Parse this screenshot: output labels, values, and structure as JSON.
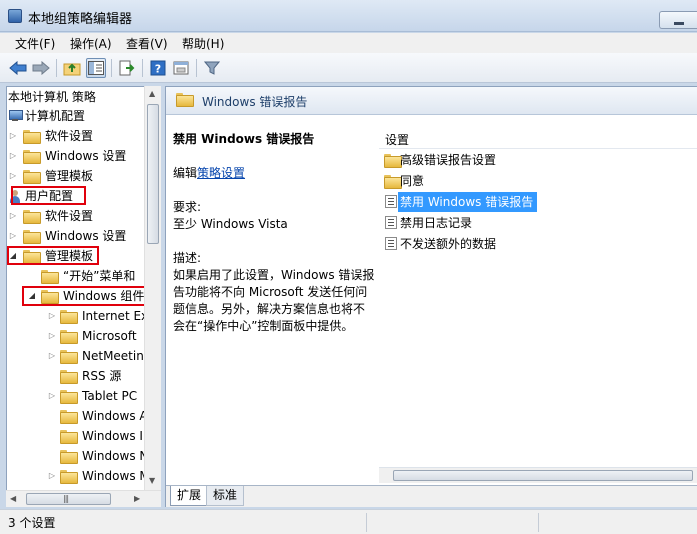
{
  "window": {
    "title": "本地组策略编辑器"
  },
  "menu": {
    "items": [
      "文件(F)",
      "操作(A)",
      "查看(V)",
      "帮助(H)"
    ]
  },
  "toolbar": {
    "icons": [
      "back-arrow-icon",
      "forward-arrow-icon",
      "up-folder-icon",
      "show-hide-tree-icon",
      "export-list-icon",
      "help-icon",
      "properties-icon",
      "filter-icon"
    ]
  },
  "tree": {
    "root": "本地计算机 策略",
    "items": [
      {
        "label": "计算机配置",
        "level": 0,
        "icon": "computer-config-icon"
      },
      {
        "label": "软件设置",
        "level": 1
      },
      {
        "label": "Windows 设置",
        "level": 1
      },
      {
        "label": "管理模板",
        "level": 1
      },
      {
        "label": "用户配置",
        "level": 0,
        "icon": "user-config-icon"
      },
      {
        "label": "软件设置",
        "level": 1
      },
      {
        "label": "Windows 设置",
        "level": 1
      },
      {
        "label": "管理模板",
        "level": 1
      },
      {
        "label": "“开始”菜单和",
        "level": 2
      },
      {
        "label": "Windows 组件",
        "level": 2
      },
      {
        "label": "Internet Ex",
        "level": 3
      },
      {
        "label": "Microsoft",
        "level": 3
      },
      {
        "label": "NetMeetin",
        "level": 3
      },
      {
        "label": "RSS 源",
        "level": 3
      },
      {
        "label": "Tablet PC",
        "level": 3
      },
      {
        "label": "Windows A",
        "level": 3
      },
      {
        "label": "Windows I",
        "level": 3
      },
      {
        "label": "Windows N",
        "level": 3
      },
      {
        "label": "Windows M",
        "level": 3
      }
    ]
  },
  "right": {
    "header_title": "Windows 错误报告",
    "desc_title": "禁用 Windows 错误报告",
    "edit_prefix": "编辑",
    "edit_link": "策略设置",
    "requirements_label": "要求:",
    "requirements_value": "至少 Windows Vista",
    "description_label": "描述:",
    "description_lines": [
      "如果启用了此设置，Windows 错误报",
      "告功能将不向 Microsoft 发送任何问",
      "题信息。另外，解决方案信息也将不",
      "会在“操作中心”控制面板中提供。"
    ],
    "list_header": "设置",
    "list": [
      {
        "label": "高级错误报告设置",
        "icon": "folder-icon"
      },
      {
        "label": "同意",
        "icon": "folder-icon"
      },
      {
        "label": "禁用 Windows 错误报告",
        "icon": "setting-icon",
        "selected": true
      },
      {
        "label": "禁用日志记录",
        "icon": "setting-icon"
      },
      {
        "label": "不发送额外的数据",
        "icon": "setting-icon"
      }
    ],
    "tabs": [
      "扩展",
      "标准"
    ]
  },
  "status": {
    "text": "3 个设置"
  }
}
